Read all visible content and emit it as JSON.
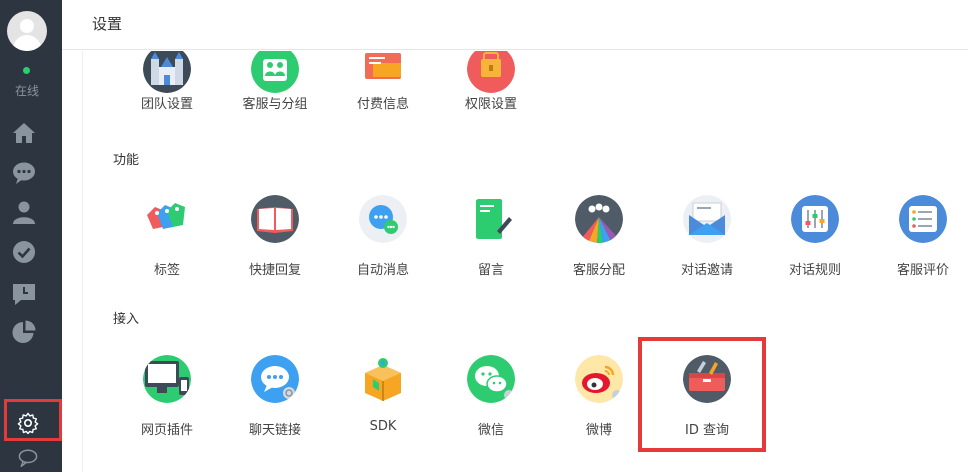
{
  "sidebar": {
    "status": "在线"
  },
  "header": {
    "title": "设置"
  },
  "sections": [
    {
      "title": "",
      "items": [
        {
          "label": "团队设置",
          "color": "#3d4a57"
        },
        {
          "label": "客服与分组",
          "color": "#2ecc71"
        },
        {
          "label": "付费信息",
          "color": "#f26b57"
        },
        {
          "label": "权限设置",
          "color": "#f05c5c"
        }
      ]
    },
    {
      "title": "功能",
      "items": [
        {
          "label": "标签",
          "color": "#ffffff"
        },
        {
          "label": "快捷回复",
          "color": "#4f5b66"
        },
        {
          "label": "自动消息",
          "color": "#eceff3"
        },
        {
          "label": "留言",
          "color": "#ffffff"
        },
        {
          "label": "客服分配",
          "color": "#4f5b66"
        },
        {
          "label": "对话邀请",
          "color": "#eceff3"
        },
        {
          "label": "对话规则",
          "color": "#4c8bd9"
        },
        {
          "label": "客服评价",
          "color": "#4c8bd9"
        }
      ]
    },
    {
      "title": "接入",
      "items": [
        {
          "label": "网页插件",
          "color": "#2ecc71"
        },
        {
          "label": "聊天链接",
          "color": "#3ea0f0"
        },
        {
          "label": "SDK",
          "color": "#ffffff"
        },
        {
          "label": "微信",
          "color": "#2ecc71"
        },
        {
          "label": "微博",
          "color": "#ffe7a8"
        },
        {
          "label": "ID 查询",
          "color": "#4f5b66"
        }
      ]
    }
  ]
}
